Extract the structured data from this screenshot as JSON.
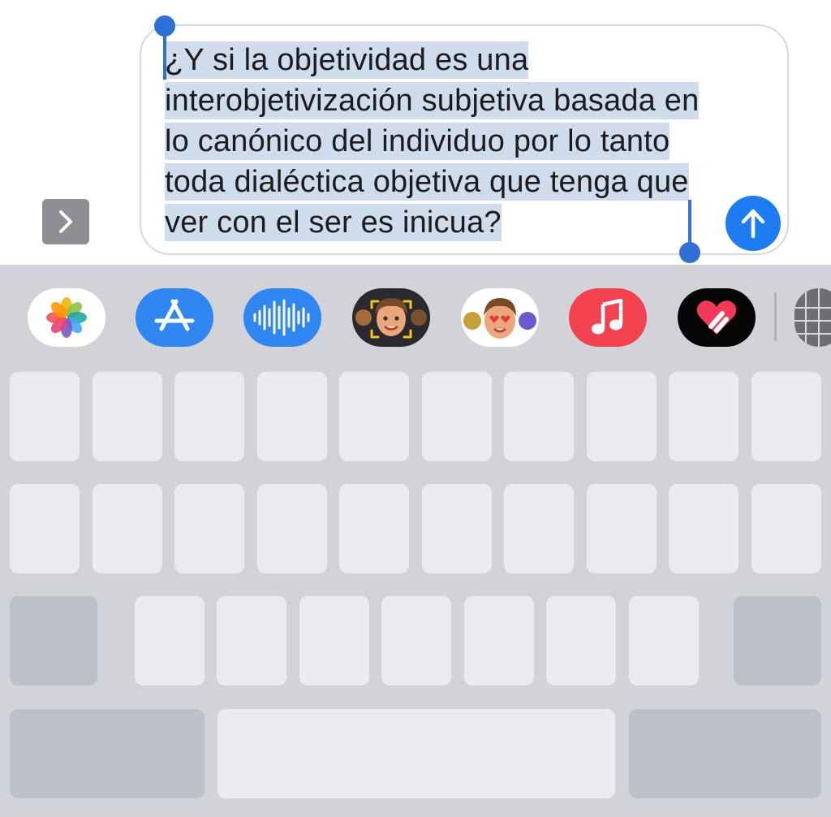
{
  "composer": {
    "text": "¿Y si la objetividad es una interobjetivización subjetiva basada en lo canónico del individuo por lo tanto toda dialéctica objetiva que tenga que ver con el ser es inicua?",
    "selection_color": "#cfdcec",
    "handle_color": "#2f6fd6"
  },
  "send_button": {
    "icon": "arrow-up-icon",
    "color": "#1e7cf2"
  },
  "expand_button": {
    "icon": "chevron-right-icon"
  },
  "app_drawer": [
    {
      "name": "Photos",
      "icon": "photos-icon"
    },
    {
      "name": "App Store",
      "icon": "app-store-icon"
    },
    {
      "name": "Audio Message",
      "icon": "waveform-icon"
    },
    {
      "name": "Memoji Stickers",
      "icon": "memoji-icon"
    },
    {
      "name": "Animoji Stickers",
      "icon": "animoji-icon"
    },
    {
      "name": "Music",
      "icon": "music-note-icon"
    },
    {
      "name": "Digital Touch",
      "icon": "heart-touch-icon"
    },
    {
      "name": "More Apps",
      "icon": "more-apps-icon"
    }
  ]
}
